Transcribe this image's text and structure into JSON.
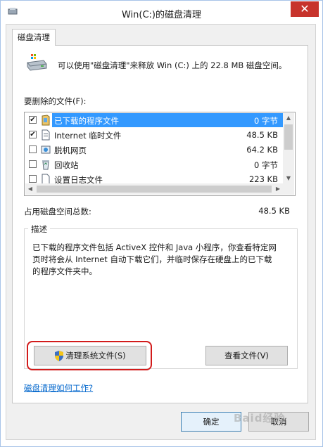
{
  "window": {
    "title": "Win(C:)的磁盘清理",
    "close_glyph": "✕"
  },
  "tab": {
    "label": "磁盘清理"
  },
  "intro": {
    "text": "可以使用\"磁盘清理\"来释放 Win (C:) 上的 22.8 MB 磁盘空间。"
  },
  "files": {
    "label": "要删除的文件(F):",
    "items": [
      {
        "name": "已下载的程序文件",
        "size": "0 字节",
        "checked": true,
        "selected": true,
        "icon": "downloaded-program-files-icon"
      },
      {
        "name": "Internet 临时文件",
        "size": "48.5 KB",
        "checked": true,
        "selected": false,
        "icon": "temp-internet-files-icon"
      },
      {
        "name": "脱机网页",
        "size": "64.2 KB",
        "checked": false,
        "selected": false,
        "icon": "offline-webpages-icon"
      },
      {
        "name": "回收站",
        "size": "0 字节",
        "checked": false,
        "selected": false,
        "icon": "recycle-bin-icon"
      },
      {
        "name": "设置日志文件",
        "size": "223 KB",
        "checked": false,
        "selected": false,
        "icon": "setup-log-files-icon"
      }
    ]
  },
  "total": {
    "label": "占用磁盘空间总数:",
    "value": "48.5 KB"
  },
  "description": {
    "legend": "描述",
    "lines": [
      "已下载的程序文件包括 ActiveX 控件和 Java 小程序，你查看特定网",
      "页时将会从 Internet 自动下载它们，并临时保存在硬盘上的已下载",
      "的程序文件夹中。"
    ]
  },
  "buttons": {
    "clean_system": "清理系统文件(S)",
    "view_files": "查看文件(V)",
    "ok": "确定",
    "cancel": "取消"
  },
  "help_link": "磁盘清理如何工作?",
  "watermark": "Baid经验",
  "colors": {
    "selection": "#3399ff",
    "highlight_ring": "#d21b1b",
    "close": "#c7332c",
    "link": "#0066cc"
  }
}
